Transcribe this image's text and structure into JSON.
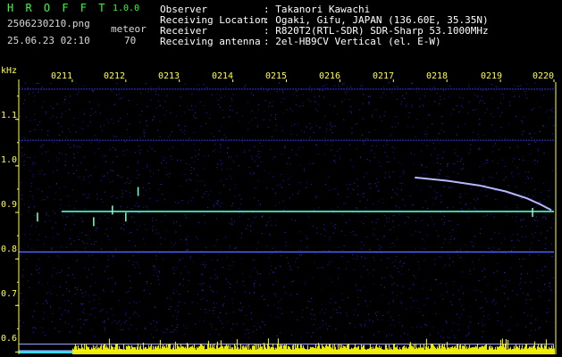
{
  "header": {
    "app_title": "H R O F F T",
    "app_version": "1.0.0",
    "file_name": "2506230210.png",
    "timestamp": "25.06.23 02:10",
    "meteor_label": "meteor",
    "meteor_count": "70",
    "info": [
      {
        "label": "Observer",
        "value": ": Takanori Kawachi"
      },
      {
        "label": "Receiving Location",
        "value": ": Ogaki, Gifu, JAPAN (136.60E, 35.35N)"
      },
      {
        "label": "Receiver",
        "value": ": R820T2(RTL-SDR) SDR-Sharp 53.1000MHz"
      },
      {
        "label": "Receiving antenna",
        "value": ": 2el-HB9CV Vertical (el. E-W)"
      }
    ]
  },
  "colors": {
    "background": "#000000",
    "title": "#33ff33",
    "labels": "#ffff44",
    "trace": "#4affd0",
    "noise": "#2a2ad0",
    "histogram": "#ffff00",
    "baseline": "#36d9ff"
  },
  "chart_data": {
    "type": "heatmap",
    "y_unit_label": "kHz",
    "x_tick_labels": [
      "0211",
      "0212",
      "0213",
      "0214",
      "0215",
      "0216",
      "0217",
      "0218",
      "0219",
      "0220"
    ],
    "y_tick_labels": [
      "1.1",
      "1.0",
      "0.9",
      "0.8",
      "0.7",
      "0.6"
    ],
    "y_ticks": [
      1.1,
      1.0,
      0.9,
      0.8,
      0.7,
      0.6
    ],
    "x_range_minutes": [
      0,
      10
    ],
    "y_range_khz": [
      0.595,
      1.18
    ],
    "horizontal_traces": [
      {
        "freq_khz": 0.902,
        "x_start_min": 0.8,
        "x_end_min": 10.0,
        "color": "#4affd0",
        "strength": "strong"
      },
      {
        "freq_khz": 0.815,
        "x_start_min": 0.0,
        "x_end_min": 10.0,
        "color": "#4a6aff",
        "strength": "medium"
      },
      {
        "freq_khz": 1.055,
        "x_start_min": 0.0,
        "x_end_min": 10.0,
        "color": "#2f2fe0",
        "strength": "weak"
      },
      {
        "freq_khz": 1.165,
        "x_start_min": 0.0,
        "x_end_min": 10.0,
        "color": "#2f2fe0",
        "strength": "weak"
      }
    ],
    "curved_trace": {
      "points_min_khz": [
        [
          7.4,
          0.975
        ],
        [
          8.0,
          0.968
        ],
        [
          8.6,
          0.958
        ],
        [
          9.1,
          0.945
        ],
        [
          9.5,
          0.93
        ],
        [
          9.75,
          0.917
        ],
        [
          9.95,
          0.905
        ]
      ],
      "color": "#b8b8ff"
    },
    "short_echoes": [
      {
        "x_min": 0.35,
        "freq_khz": 0.89
      },
      {
        "x_min": 1.4,
        "freq_khz": 0.88
      },
      {
        "x_min": 2.0,
        "freq_khz": 0.89
      },
      {
        "x_min": 2.23,
        "freq_khz": 0.945
      },
      {
        "x_min": 1.75,
        "freq_khz": 0.905
      },
      {
        "x_min": 9.6,
        "freq_khz": 0.9
      }
    ],
    "reference_lines_khz": [
      0.617,
      0.603
    ],
    "grid": false
  }
}
